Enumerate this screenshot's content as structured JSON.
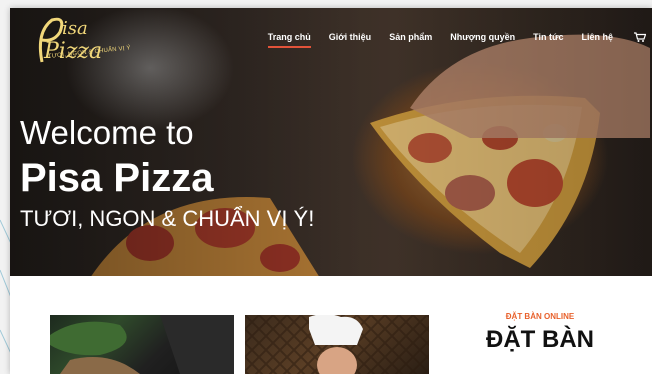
{
  "logo": {
    "text": "Pisa Pizza",
    "tagline": "TƯƠI, NGON & CHUẨN VỊ Ý"
  },
  "nav": {
    "items": [
      {
        "label": "Trang chủ",
        "active": true
      },
      {
        "label": "Giới thiệu",
        "active": false
      },
      {
        "label": "Sản phẩm",
        "active": false
      },
      {
        "label": "Nhượng quyền",
        "active": false
      },
      {
        "label": "Tin tức",
        "active": false
      },
      {
        "label": "Liên hệ",
        "active": false
      }
    ],
    "cart_icon": "cart-icon"
  },
  "hero": {
    "welcome": "Welcome to",
    "brand": "Pisa Pizza",
    "tagline": "TƯƠI, NGON & CHUẨN VỊ Ý!"
  },
  "reservation": {
    "kicker": "ĐẶT BÀN ONLINE",
    "title": "ĐẶT BÀN"
  },
  "colors": {
    "accent": "#e2533a",
    "kicker": "#e8612c",
    "logo": "#f1d77a"
  }
}
